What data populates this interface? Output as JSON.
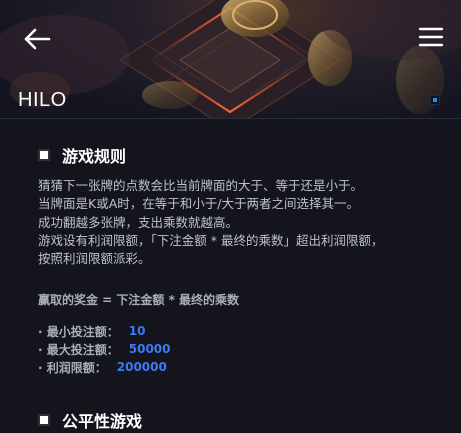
{
  "header": {
    "title": "HILO",
    "back_icon": "arrow-left-icon",
    "menu_icon": "hamburger-menu-icon"
  },
  "rules": {
    "heading": "游戏规则",
    "lines": [
      "猜猜下一张牌的点数会比当前牌面的大于、等于还是小于。",
      "当牌面是K或A时，在等于和小于/大于两者之间选择其一。",
      "成功翻越多张牌，支出乘数就越高。",
      "游戏设有利润限额，「下注金额 * 最终的乘数」超出利润限额，",
      "按照利润限额派彩。"
    ],
    "formula": "赢取的奖金 = 下注金额 * 最终的乘数",
    "limits": [
      {
        "label": "· 最小投注额：",
        "value": "10"
      },
      {
        "label": "· 最大投注额：",
        "value": "50000"
      },
      {
        "label": "· 利润限额：",
        "value": "200000"
      }
    ]
  },
  "fairness": {
    "heading": "公平性游戏"
  },
  "colors": {
    "background": "#13141c",
    "accent_blue": "#3d7bf5",
    "dot_blue": "#1f8ff0",
    "title_white": "#ffffff"
  }
}
